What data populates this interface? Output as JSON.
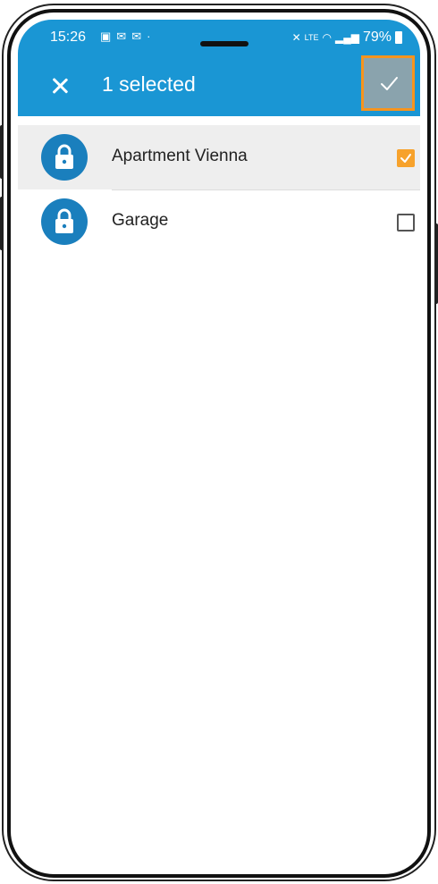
{
  "statusbar": {
    "time": "15:26",
    "left_icons": [
      "image-icon",
      "mail-icon",
      "mail-icon",
      "dot-icon"
    ],
    "right_icons": [
      "mute-icon",
      "volte-icon",
      "wifi-icon",
      "signal-icon"
    ],
    "battery": "79%"
  },
  "appbar": {
    "title": "1 selected",
    "close_icon": "close-icon",
    "confirm_icon": "check-icon",
    "color": "#1a96d4",
    "highlight_color": "#f7941d"
  },
  "items": [
    {
      "label": "Apartment Vienna",
      "icon": "lock-icon",
      "checked": true
    },
    {
      "label": "Garage",
      "icon": "lock-icon",
      "checked": false
    }
  ]
}
